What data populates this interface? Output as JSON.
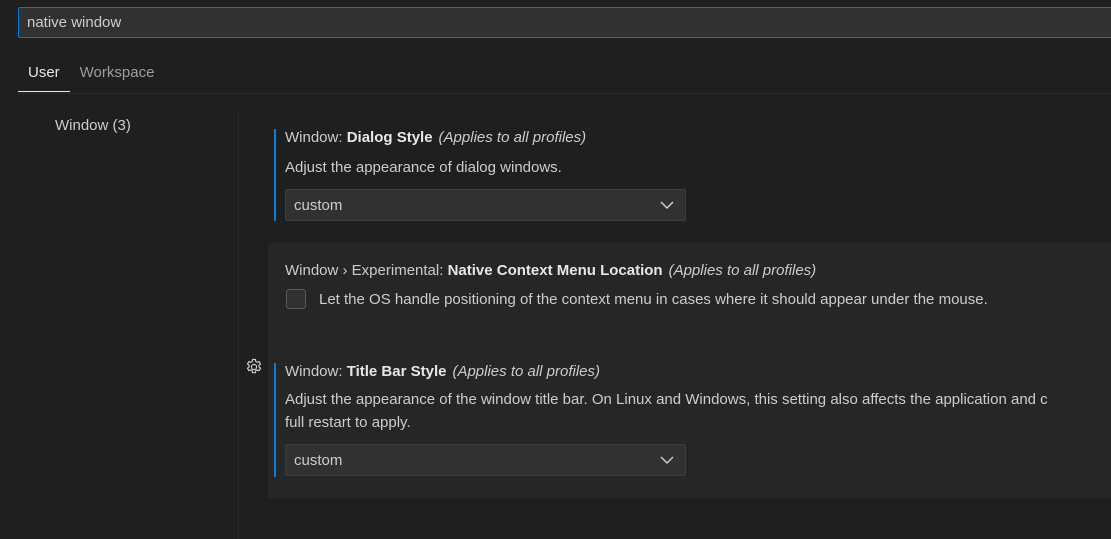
{
  "search": {
    "value": "native window"
  },
  "tabs": [
    {
      "label": "User",
      "active": true
    },
    {
      "label": "Workspace",
      "active": false
    }
  ],
  "toc": {
    "items": [
      {
        "label": "Window (3)"
      }
    ]
  },
  "settings": [
    {
      "category": "Window: ",
      "name": "Dialog Style",
      "scope": "(Applies to all profiles)",
      "description": "Adjust the appearance of dialog windows.",
      "value": "custom"
    },
    {
      "category": "Window › Experimental: ",
      "name": "Native Context Menu Location",
      "scope": "(Applies to all profiles)",
      "description": "Let the OS handle positioning of the context menu in cases where it should appear under the mouse."
    },
    {
      "category": "Window: ",
      "name": "Title Bar Style",
      "scope": "(Applies to all profiles)",
      "description_line1": "Adjust the appearance of the window title bar. On Linux and Windows, this setting also affects the application and c",
      "description_line2": "full restart to apply.",
      "value": "custom"
    }
  ],
  "colors": {
    "accent": "#0078d4",
    "modified_indicator": "#0c7dd8",
    "background": "#1f1f1f"
  },
  "icons": {
    "dropdown": "chevron-down-icon",
    "manage": "gear-icon"
  }
}
